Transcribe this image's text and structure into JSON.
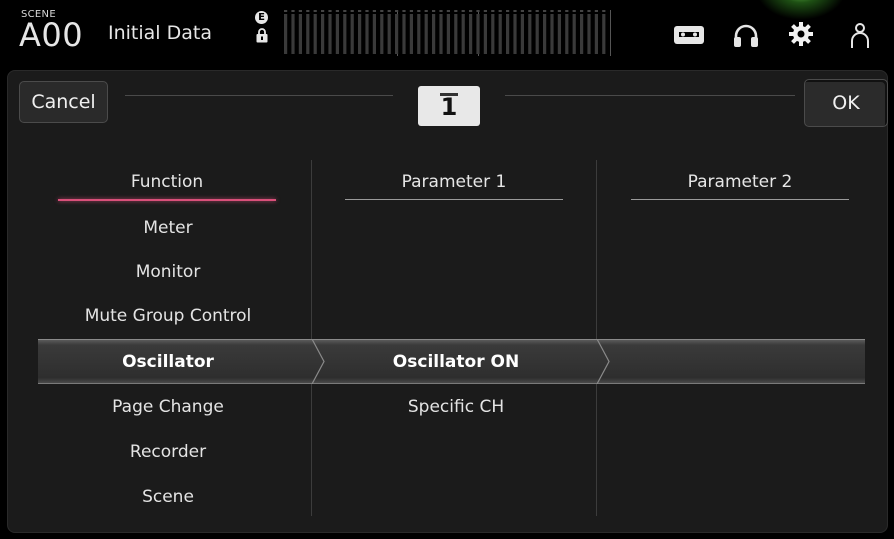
{
  "top_bar": {
    "scene_label": "SCENE",
    "scene_number": "A00",
    "scene_name": "Initial Data",
    "edit_badge": "E",
    "icons": [
      "recorder-icon",
      "headphones-icon",
      "settings-gear-icon",
      "user-icon"
    ],
    "colors": {
      "settings_glow": "#6fd452"
    }
  },
  "dialog": {
    "cancel_label": "Cancel",
    "ok_label": "OK",
    "channel": "1"
  },
  "columns": {
    "function": {
      "header": "Function",
      "items": [
        "Meter",
        "Monitor",
        "Mute Group Control",
        "Oscillator",
        "Page Change",
        "Recorder",
        "Scene"
      ],
      "selected": "Oscillator"
    },
    "parameter1": {
      "header": "Parameter 1",
      "items": [
        "Oscillator ON",
        "Specific CH"
      ],
      "selected": "Oscillator ON"
    },
    "parameter2": {
      "header": "Parameter 2",
      "items": []
    }
  },
  "colors": {
    "active_underline": "#d9507a",
    "panel_bg": "#1b1b1b"
  }
}
